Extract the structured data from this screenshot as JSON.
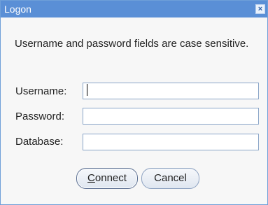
{
  "window": {
    "title": "Logon",
    "close_glyph": "×",
    "accent_color": "#5a8fd6"
  },
  "message": "Username and password fields are case sensitive.",
  "fields": {
    "username": {
      "label": "Username:",
      "value": ""
    },
    "password": {
      "label": "Password:",
      "value": ""
    },
    "database": {
      "label": "Database:",
      "value": ""
    }
  },
  "buttons": {
    "connect": {
      "mnemonic": "C",
      "rest": "onnect"
    },
    "cancel": "Cancel"
  }
}
